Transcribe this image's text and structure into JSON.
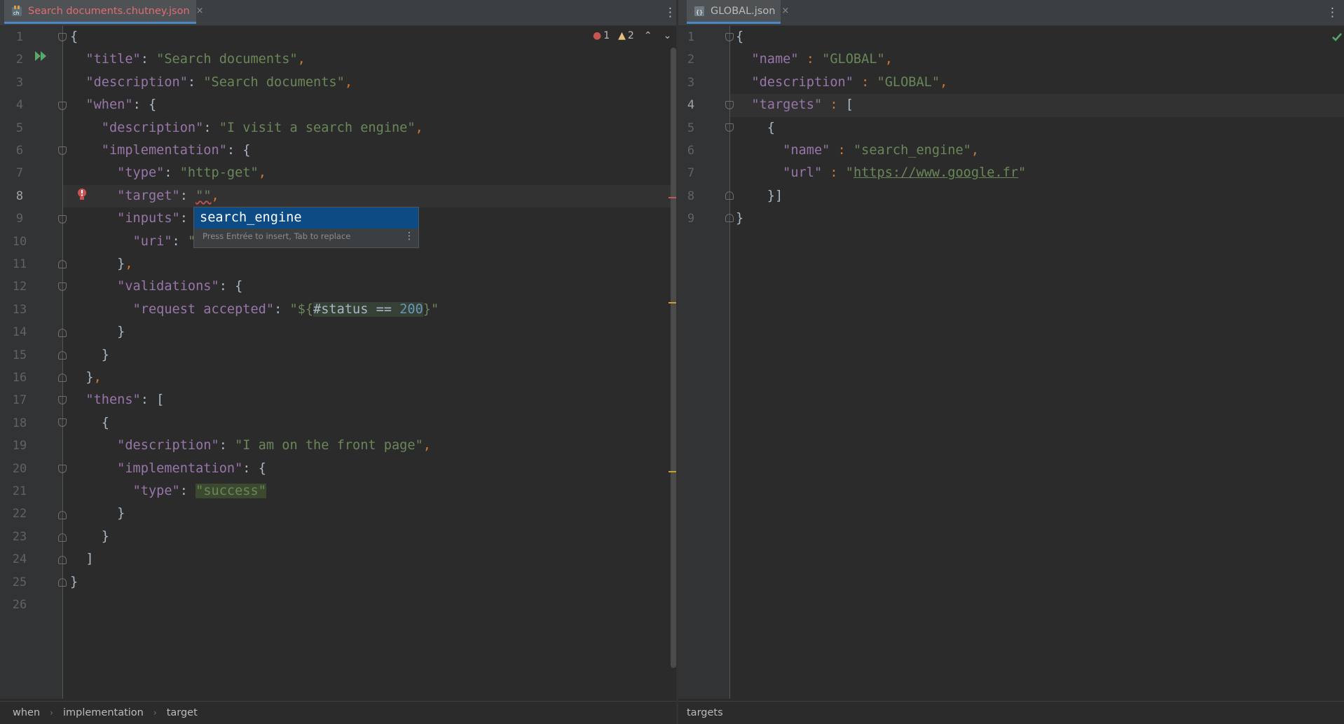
{
  "left": {
    "tab": {
      "title": "Search documents.chutney.json",
      "close": "×",
      "icon": "chutney-json-file-icon",
      "color": "#e06c75"
    },
    "inspections": {
      "errors": "1",
      "warnings": "2",
      "up": "⌃",
      "down": "⌄"
    },
    "line_numbers": [
      "1",
      "2",
      "3",
      "4",
      "5",
      "6",
      "7",
      "8",
      "9",
      "10",
      "11",
      "12",
      "13",
      "14",
      "15",
      "16",
      "17",
      "18",
      "19",
      "20",
      "21",
      "22",
      "23",
      "24",
      "25",
      "26"
    ],
    "code": {
      "l1_brace": "{",
      "l2_key": "\"title\"",
      "l2_val": "\"Search documents\"",
      "l3_key": "\"description\"",
      "l3_val": "\"Search documents\"",
      "l4_key": "\"when\"",
      "l4_brace": "{",
      "l5_key": "\"description\"",
      "l5_val": "\"I visit a search engine\"",
      "l6_key": "\"implementation\"",
      "l6_brace": "{",
      "l7_key": "\"type\"",
      "l7_val": "\"http-get\"",
      "l8_key": "\"target\"",
      "l8_val": "\"\"",
      "l9_key": "\"inputs\"",
      "l10_key": "\"uri\"",
      "l10_val": "\"",
      "l11_close": "}",
      "l12_key": "\"validations\"",
      "l12_brace": "{",
      "l13_key": "\"request accepted\"",
      "l13_val_a": "\"${",
      "l13_val_b": "#status",
      "l13_val_c": " == ",
      "l13_val_d": "200",
      "l13_val_e": "}\"",
      "l14_close": "}",
      "l15_close": "}",
      "l16_close": "}",
      "l17_key": "\"thens\"",
      "l17_bracket": "[",
      "l18_open": "{",
      "l19_key": "\"description\"",
      "l19_val": "\"I am on the front page\"",
      "l20_key": "\"implementation\"",
      "l20_brace": "{",
      "l21_key": "\"type\"",
      "l21_val": "\"success\"",
      "l22_close": "}",
      "l23_close": "}",
      "l24_close": "]",
      "l25_close": "}"
    },
    "completion": {
      "item": "search_engine",
      "hint": "Press Entrée to insert, Tab to replace"
    },
    "breadcrumbs": [
      "when",
      "implementation",
      "target"
    ]
  },
  "right": {
    "tab": {
      "title": "GLOBAL.json",
      "close": "×",
      "icon": "json-file-icon"
    },
    "line_numbers": [
      "1",
      "2",
      "3",
      "4",
      "5",
      "6",
      "7",
      "8",
      "9"
    ],
    "code": {
      "l1_brace": "{",
      "l2_key": "\"name\"",
      "l2_val": "\"GLOBAL\"",
      "l3_key": "\"description\"",
      "l3_val": "\"GLOBAL\"",
      "l4_key": "\"targets\"",
      "l4_bracket": "[",
      "l5_open": "{",
      "l6_key": "\"name\"",
      "l6_val": "\"search_engine\"",
      "l7_key": "\"url\"",
      "l7_q1": "\"",
      "l7_url": "https://www.google.fr",
      "l7_q2": "\"",
      "l8_close": "}]",
      "l9_close": "}"
    },
    "status_icon": "checkmark-icon",
    "breadcrumbs": [
      "targets"
    ]
  },
  "colors": {
    "key": "#9876aa",
    "string": "#6a8759",
    "punct": "#cc7832",
    "number": "#6897bb",
    "selection": "#0d4b84",
    "error": "#c75450",
    "warning": "#e5c07b",
    "ok": "#59a869",
    "run": "#59a869"
  }
}
